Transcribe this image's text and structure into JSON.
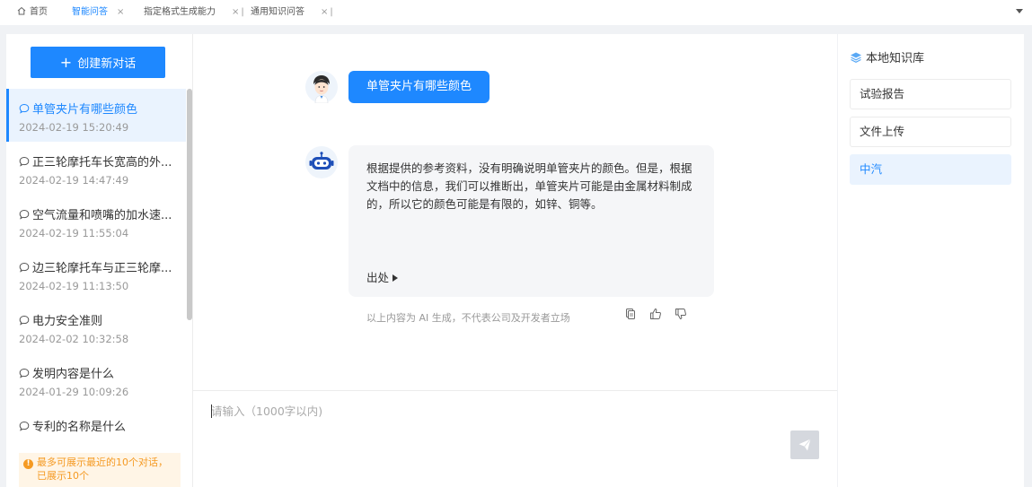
{
  "tabs": [
    {
      "label": "首页",
      "icon": "home-icon",
      "closable": false
    },
    {
      "label": "智能问答",
      "active": true,
      "closable": true
    },
    {
      "label": "指定格式生成能力",
      "closable": true
    },
    {
      "label": "通用知识问答",
      "closable": true
    }
  ],
  "tab_close_glyph": "×",
  "tab_separator": "|",
  "sidebar": {
    "new_chat_label": "创建新对话",
    "conversations": [
      {
        "title": "单管夹片有哪些颜色",
        "time": "2024-02-19 15:20:49",
        "active": true
      },
      {
        "title": "正三轮摩托车长宽高的外...",
        "time": "2024-02-19 14:47:49"
      },
      {
        "title": "空气流量和喷嘴的加水速...",
        "time": "2024-02-19 11:55:04"
      },
      {
        "title": "边三轮摩托车与正三轮摩...",
        "time": "2024-02-19 11:13:50"
      },
      {
        "title": "电力安全准则",
        "time": "2024-02-02 10:32:58"
      },
      {
        "title": "发明内容是什么",
        "time": "2024-01-29 10:09:26"
      },
      {
        "title": "专利的名称是什么",
        "time": ""
      }
    ],
    "notice": "最多可展示最近的10个对话，已展示10个"
  },
  "chat": {
    "user_message": "单管夹片有哪些颜色",
    "bot_message": " 根据提供的参考资料，没有明确说明单管夹片的颜色。但是，根据文档中的信息，我们可以推断出，单管夹片可能是由金属材料制成的，所以它的颜色可能是有限的，如锌、铜等。",
    "source_label": "出处",
    "disclaimer": "以上内容为 AI 生成，不代表公司及开发者立场",
    "input_placeholder": "请输入（1000字以内)"
  },
  "knowledge": {
    "title": "本地知识库",
    "items": [
      {
        "label": "试验报告"
      },
      {
        "label": "文件上传"
      },
      {
        "label": "中汽",
        "active": true
      }
    ]
  },
  "colors": {
    "accent": "#1e88ff",
    "warning": "#f59a23",
    "active_bg": "#eaf3fe"
  }
}
